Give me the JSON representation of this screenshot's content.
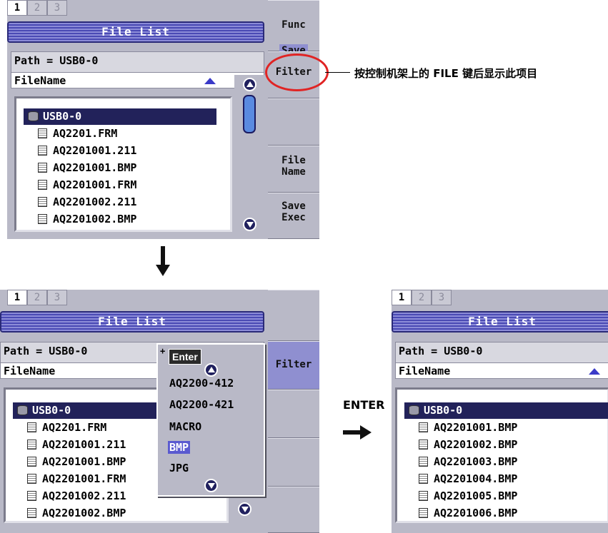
{
  "tabs": [
    "1",
    "2",
    "3"
  ],
  "title": "File List",
  "path_text": "Path = USB0-0",
  "column_header": "FileName",
  "softkeys_top": {
    "func_label": "Func",
    "func_value": "Save",
    "filter": "Filter",
    "file_name": "File\nName",
    "save_exec": "Save\nExec"
  },
  "softkeys_bottom": {
    "filter": "Filter"
  },
  "annotation": "按控制机架上的 FILE 键后显示此项目",
  "enter_label": "ENTER",
  "drive_name": "USB0-0",
  "files_before": [
    "AQ2201.FRM",
    "AQ2201001.211",
    "AQ2201001.BMP",
    "AQ2201001.FRM",
    "AQ2201002.211",
    "AQ2201002.BMP"
  ],
  "files_after": [
    "AQ2201001.BMP",
    "AQ2201002.BMP",
    "AQ2201003.BMP",
    "AQ2201004.BMP",
    "AQ2201005.BMP",
    "AQ2201006.BMP"
  ],
  "filter_popup": {
    "plus": "+",
    "enter": "Enter",
    "options": [
      "AQ2200-412",
      "AQ2200-421",
      "MACRO",
      "BMP",
      "JPG"
    ],
    "selected": "BMP"
  },
  "colors": {
    "titlebar": "#4a4ab4",
    "selection": "#22225a",
    "highlight_circle": "#e02424",
    "softkey_active": "#8f8fd0"
  }
}
